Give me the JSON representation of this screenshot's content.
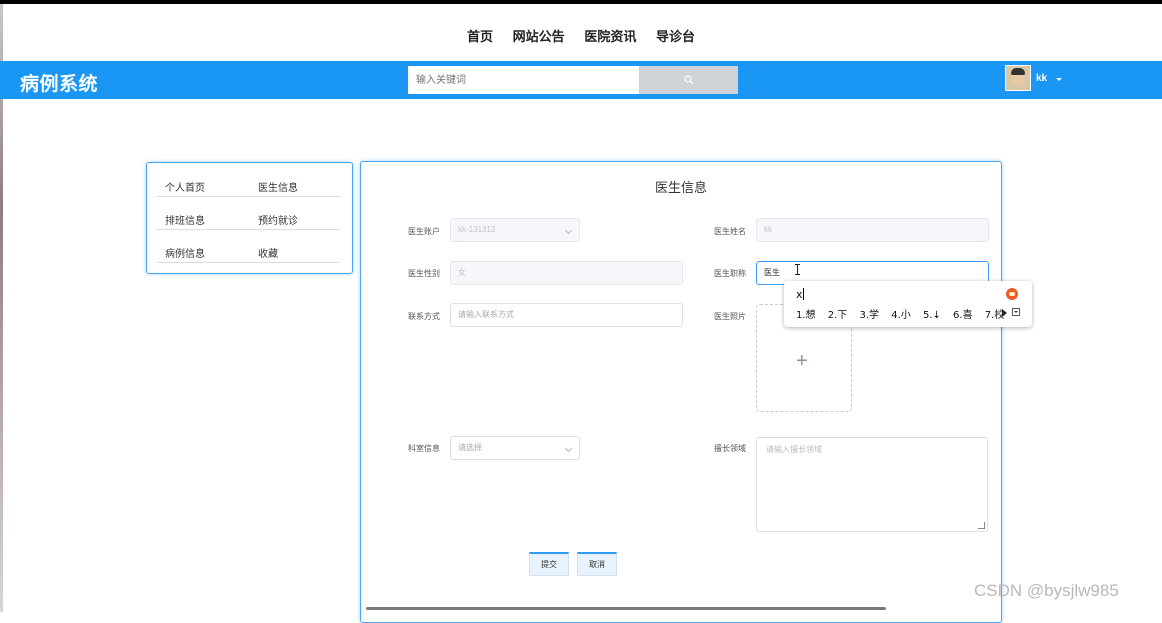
{
  "nav": {
    "items": [
      "首页",
      "网站公告",
      "医院资讯",
      "导诊台"
    ]
  },
  "header": {
    "brand": "病例系统",
    "search_placeholder": "输入关键词",
    "username": "kk",
    "bg_color": "#1a96f4"
  },
  "sidebar": {
    "rows": [
      [
        "个人首页",
        "医生信息"
      ],
      [
        "排班信息",
        "预约就诊"
      ],
      [
        "病例信息",
        "收藏"
      ]
    ]
  },
  "form": {
    "title": "医生信息",
    "account_label": "医生账户",
    "account_value": "kk-131313",
    "name_label": "医生姓名",
    "name_value": "kk",
    "gender_label": "医生性别",
    "gender_value": "女",
    "title_label": "医生职称",
    "title_value": "医生",
    "contact_label": "联系方式",
    "contact_placeholder": "请输入联系方式",
    "photo_label": "医生照片",
    "dept_label": "科室信息",
    "dept_placeholder": "请选择",
    "expertise_label": "擅长领域",
    "expertise_placeholder": "请输入擅长领域",
    "submit_label": "提交",
    "cancel_label": "取消"
  },
  "ime": {
    "typed": "x",
    "candidates": [
      "1.想",
      "2.下",
      "3.学",
      "4.小",
      "5.↓",
      "6.喜",
      "7.校"
    ]
  },
  "watermark": "CSDN @bysjlw985"
}
